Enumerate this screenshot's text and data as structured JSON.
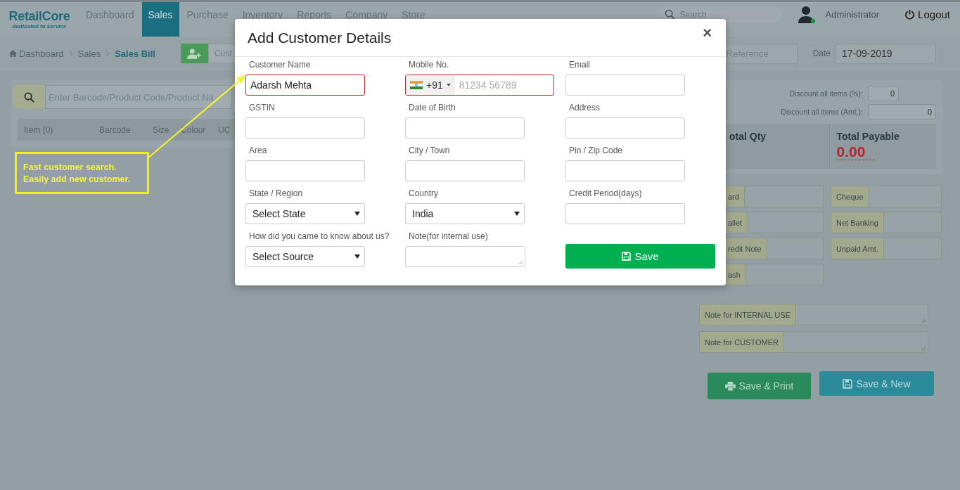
{
  "header": {
    "logo": {
      "name": "RetailCore",
      "tagline": "dedicated to service"
    },
    "nav": [
      {
        "label": "Dashboard",
        "selected": false
      },
      {
        "label": "Sales",
        "selected": true
      },
      {
        "label": "Purchase",
        "selected": false
      },
      {
        "label": "Inventory",
        "selected": false
      },
      {
        "label": "Reports",
        "selected": false
      },
      {
        "label": "Company",
        "selected": false
      },
      {
        "label": "Store",
        "selected": false
      }
    ],
    "search": {
      "placeholder": "Search"
    },
    "user": {
      "name": "Administrator",
      "online": true
    },
    "logout": "Logout"
  },
  "toolbar": {
    "breadcrumb": [
      "Dashboard",
      "Sales",
      "Sales Bill"
    ],
    "customer_field": {
      "placeholder": "Cust"
    },
    "reference": {
      "placeholder": "Reference"
    },
    "date": {
      "label": "Date",
      "value": "17-09-2019"
    }
  },
  "product_search": {
    "placeholder": "Enter Barcode/Product Code/Product Na"
  },
  "table": {
    "columns": [
      "Item (0)",
      "Barcode",
      "Size",
      "Colour",
      "UC"
    ]
  },
  "summary": {
    "discounts": [
      {
        "label": "Discount all items (%):",
        "value": "0"
      },
      {
        "label": "Discount all items (Amt.):",
        "value": "0"
      }
    ],
    "totals": [
      {
        "label": "otal Qty"
      },
      {
        "label": "Total Payable",
        "value": "0.00"
      }
    ]
  },
  "payments": {
    "left": [
      "ard",
      "allet",
      "redit Note",
      "ash"
    ],
    "right": [
      "Cheque",
      "Net Banking",
      "Unpaid Amt."
    ]
  },
  "notes": [
    "Note for INTERNAL USE",
    "Note for CUSTOMER"
  ],
  "actions": [
    {
      "label": "Save & Print",
      "kind": "print"
    },
    {
      "label": "Save & New",
      "kind": "new"
    }
  ],
  "modal": {
    "title": "Add Customer Details",
    "close": "×",
    "fields": [
      {
        "label": "Customer Name",
        "kind": "text",
        "value": "Adarsh Mehta",
        "invalid": true
      },
      {
        "label": "Mobile No.",
        "kind": "phone",
        "code": "+91",
        "placeholder": "81234 56789",
        "invalid": true
      },
      {
        "label": "Email",
        "kind": "text",
        "invalid": false
      },
      {
        "label": "GSTIN",
        "kind": "text",
        "invalid": false
      },
      {
        "label": "Date of Birth",
        "kind": "text",
        "invalid": false
      },
      {
        "label": "Address",
        "kind": "text",
        "invalid": false
      },
      {
        "label": "Area",
        "kind": "text",
        "invalid": false
      },
      {
        "label": "City / Town",
        "kind": "text",
        "invalid": false
      },
      {
        "label": "Pin / Zip Code",
        "kind": "text",
        "invalid": false
      },
      {
        "label": "State / Region",
        "kind": "select",
        "value": "Select State",
        "invalid": false
      },
      {
        "label": "Country",
        "kind": "select",
        "value": "India",
        "invalid": false
      },
      {
        "label": "Credit Period(days)",
        "kind": "text",
        "invalid": false
      },
      {
        "label": "How did you came to know about us?",
        "kind": "select",
        "value": "Select Source",
        "invalid": false
      },
      {
        "label": "Note(for internal use)",
        "kind": "textarea",
        "invalid": false
      }
    ],
    "save": "Save"
  },
  "callout": {
    "lines": [
      "Fast customer search.",
      "Easily add new customer."
    ]
  }
}
